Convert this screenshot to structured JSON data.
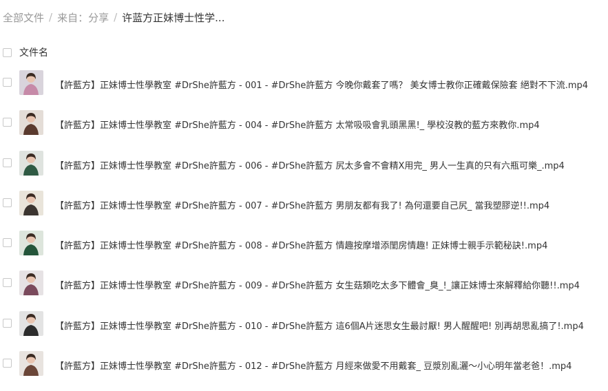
{
  "breadcrumb": {
    "all_files": "全部文件",
    "from": "来自：分享",
    "current": "许蓝方正妹博士性学...",
    "separator": "/"
  },
  "list_header": {
    "name_label": "文件名"
  },
  "files": [
    {
      "name": "【許藍方】正妹博士性學教室 #DrShe許藍方 - 001 - #DrShe許藍方 今晚你戴套了嗎？ 美女博士教你正確戴保險套 絕對不下流.mp4",
      "thumb_bg": "#d9d4dc",
      "thumb_fg": "#c68aa8"
    },
    {
      "name": "【許藍方】正妹博士性學教室 #DrShe許藍方 - 004 - #DrShe許藍方 太常吸吸會乳頭黑黑!_ 學校沒教的藍方來教你.mp4",
      "thumb_bg": "#e4ddd7",
      "thumb_fg": "#5a3a2e"
    },
    {
      "name": "【許藍方】正妹博士性學教室 #DrShe許藍方 - 006 - #DrShe許藍方 尻太多會不會精X用完_ 男人一生真的只有六瓶可樂_.mp4",
      "thumb_bg": "#dfe3df",
      "thumb_fg": "#2f5a44"
    },
    {
      "name": "【許藍方】正妹博士性學教室 #DrShe許藍方 - 007 - #DrShe許藍方 男朋友都有我了! 為何還要自己尻_ 當我塑膠逆!!.mp4",
      "thumb_bg": "#e9e4da",
      "thumb_fg": "#3b3530"
    },
    {
      "name": "【許藍方】正妹博士性學教室 #DrShe許藍方 - 008 - #DrShe許藍方 情趣按摩增添閨房情趣! 正妹博士親手示範秘訣!.mp4",
      "thumb_bg": "#dde5dc",
      "thumb_fg": "#24553a"
    },
    {
      "name": "【許藍方】正妹博士性學教室 #DrShe許藍方 - 009 - #DrShe許藍方 女生菇類吃太多下體會_臭_!_讓正妹博士來解釋給你聽!!.mp4",
      "thumb_bg": "#e6e2e4",
      "thumb_fg": "#7a4a5c"
    },
    {
      "name": "【許藍方】正妹博士性學教室 #DrShe許藍方 - 010 - #DrShe許藍方 這6個A片迷思女生最討厭! 男人醒醒吧! 別再胡思亂搞了!.mp4",
      "thumb_bg": "#e3e3e3",
      "thumb_fg": "#2c2c2c"
    },
    {
      "name": "【許藍方】正妹博士性學教室 #DrShe許藍方 - 012 - #DrShe許藍方 月經來做愛不用戴套_ 豆漿別亂灑～小心明年當老爸！.mp4",
      "thumb_bg": "#e8e3df",
      "thumb_fg": "#6a4638"
    }
  ]
}
